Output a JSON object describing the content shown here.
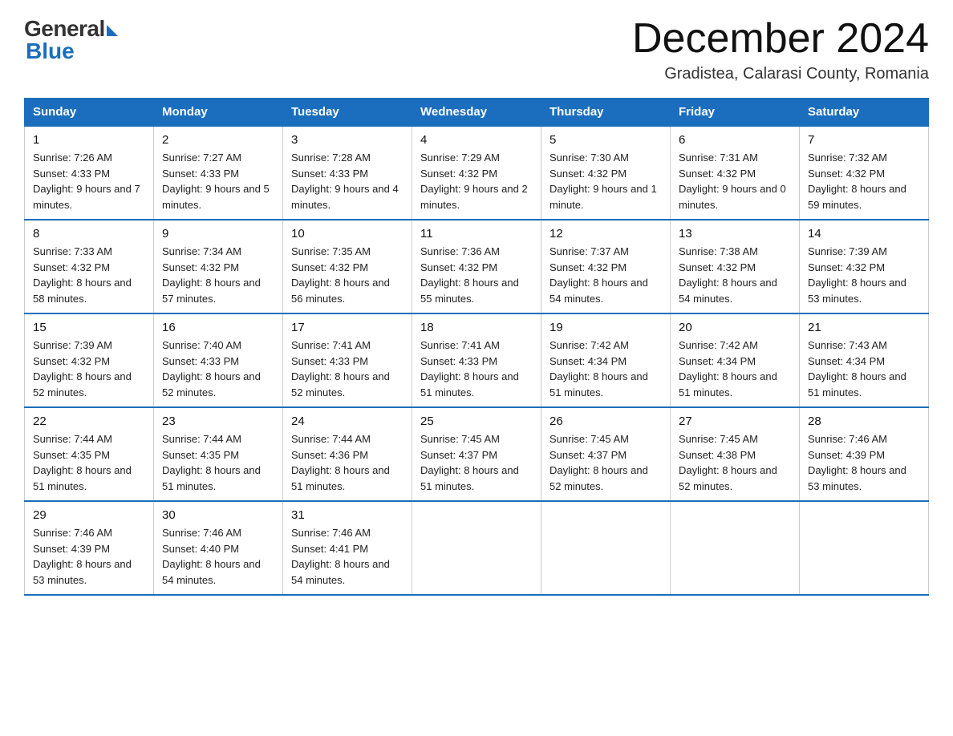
{
  "header": {
    "logo_general": "General",
    "logo_blue": "Blue",
    "month_title": "December 2024",
    "subtitle": "Gradistea, Calarasi County, Romania"
  },
  "weekdays": [
    "Sunday",
    "Monday",
    "Tuesday",
    "Wednesday",
    "Thursday",
    "Friday",
    "Saturday"
  ],
  "weeks": [
    [
      {
        "day": "1",
        "sunrise": "7:26 AM",
        "sunset": "4:33 PM",
        "daylight": "9 hours and 7 minutes."
      },
      {
        "day": "2",
        "sunrise": "7:27 AM",
        "sunset": "4:33 PM",
        "daylight": "9 hours and 5 minutes."
      },
      {
        "day": "3",
        "sunrise": "7:28 AM",
        "sunset": "4:33 PM",
        "daylight": "9 hours and 4 minutes."
      },
      {
        "day": "4",
        "sunrise": "7:29 AM",
        "sunset": "4:32 PM",
        "daylight": "9 hours and 2 minutes."
      },
      {
        "day": "5",
        "sunrise": "7:30 AM",
        "sunset": "4:32 PM",
        "daylight": "9 hours and 1 minute."
      },
      {
        "day": "6",
        "sunrise": "7:31 AM",
        "sunset": "4:32 PM",
        "daylight": "9 hours and 0 minutes."
      },
      {
        "day": "7",
        "sunrise": "7:32 AM",
        "sunset": "4:32 PM",
        "daylight": "8 hours and 59 minutes."
      }
    ],
    [
      {
        "day": "8",
        "sunrise": "7:33 AM",
        "sunset": "4:32 PM",
        "daylight": "8 hours and 58 minutes."
      },
      {
        "day": "9",
        "sunrise": "7:34 AM",
        "sunset": "4:32 PM",
        "daylight": "8 hours and 57 minutes."
      },
      {
        "day": "10",
        "sunrise": "7:35 AM",
        "sunset": "4:32 PM",
        "daylight": "8 hours and 56 minutes."
      },
      {
        "day": "11",
        "sunrise": "7:36 AM",
        "sunset": "4:32 PM",
        "daylight": "8 hours and 55 minutes."
      },
      {
        "day": "12",
        "sunrise": "7:37 AM",
        "sunset": "4:32 PM",
        "daylight": "8 hours and 54 minutes."
      },
      {
        "day": "13",
        "sunrise": "7:38 AM",
        "sunset": "4:32 PM",
        "daylight": "8 hours and 54 minutes."
      },
      {
        "day": "14",
        "sunrise": "7:39 AM",
        "sunset": "4:32 PM",
        "daylight": "8 hours and 53 minutes."
      }
    ],
    [
      {
        "day": "15",
        "sunrise": "7:39 AM",
        "sunset": "4:32 PM",
        "daylight": "8 hours and 52 minutes."
      },
      {
        "day": "16",
        "sunrise": "7:40 AM",
        "sunset": "4:33 PM",
        "daylight": "8 hours and 52 minutes."
      },
      {
        "day": "17",
        "sunrise": "7:41 AM",
        "sunset": "4:33 PM",
        "daylight": "8 hours and 52 minutes."
      },
      {
        "day": "18",
        "sunrise": "7:41 AM",
        "sunset": "4:33 PM",
        "daylight": "8 hours and 51 minutes."
      },
      {
        "day": "19",
        "sunrise": "7:42 AM",
        "sunset": "4:34 PM",
        "daylight": "8 hours and 51 minutes."
      },
      {
        "day": "20",
        "sunrise": "7:42 AM",
        "sunset": "4:34 PM",
        "daylight": "8 hours and 51 minutes."
      },
      {
        "day": "21",
        "sunrise": "7:43 AM",
        "sunset": "4:34 PM",
        "daylight": "8 hours and 51 minutes."
      }
    ],
    [
      {
        "day": "22",
        "sunrise": "7:44 AM",
        "sunset": "4:35 PM",
        "daylight": "8 hours and 51 minutes."
      },
      {
        "day": "23",
        "sunrise": "7:44 AM",
        "sunset": "4:35 PM",
        "daylight": "8 hours and 51 minutes."
      },
      {
        "day": "24",
        "sunrise": "7:44 AM",
        "sunset": "4:36 PM",
        "daylight": "8 hours and 51 minutes."
      },
      {
        "day": "25",
        "sunrise": "7:45 AM",
        "sunset": "4:37 PM",
        "daylight": "8 hours and 51 minutes."
      },
      {
        "day": "26",
        "sunrise": "7:45 AM",
        "sunset": "4:37 PM",
        "daylight": "8 hours and 52 minutes."
      },
      {
        "day": "27",
        "sunrise": "7:45 AM",
        "sunset": "4:38 PM",
        "daylight": "8 hours and 52 minutes."
      },
      {
        "day": "28",
        "sunrise": "7:46 AM",
        "sunset": "4:39 PM",
        "daylight": "8 hours and 53 minutes."
      }
    ],
    [
      {
        "day": "29",
        "sunrise": "7:46 AM",
        "sunset": "4:39 PM",
        "daylight": "8 hours and 53 minutes."
      },
      {
        "day": "30",
        "sunrise": "7:46 AM",
        "sunset": "4:40 PM",
        "daylight": "8 hours and 54 minutes."
      },
      {
        "day": "31",
        "sunrise": "7:46 AM",
        "sunset": "4:41 PM",
        "daylight": "8 hours and 54 minutes."
      },
      null,
      null,
      null,
      null
    ]
  ]
}
